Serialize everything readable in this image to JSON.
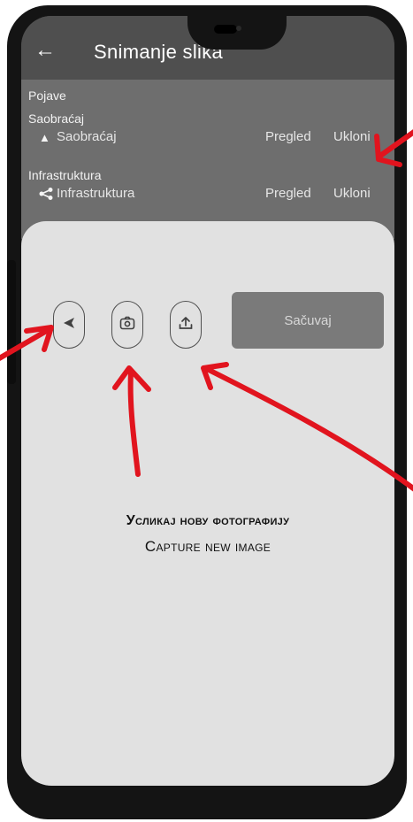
{
  "app": {
    "title": "Snimanje slika"
  },
  "sections": [
    {
      "title": "Pojave"
    },
    {
      "title": "Saobraćaj",
      "item": {
        "label": "Saobraćaj",
        "icon": "warning-icon",
        "pregled": "Pregled",
        "ukloni": "Ukloni"
      }
    },
    {
      "title": "Infrastruktura",
      "item": {
        "label": "Infrastruktura",
        "icon": "share-icon",
        "pregled": "Pregled",
        "ukloni": "Ukloni"
      }
    }
  ],
  "sheet": {
    "save_label": "Sačuvaj",
    "buttons": {
      "back": "back-triangle-icon",
      "camera": "camera-icon",
      "upload": "upload-icon"
    }
  },
  "annotation": {
    "title": "Усликај нову фотографију",
    "subtitle": "Capture new image"
  },
  "colors": {
    "arrow": "#e1141e",
    "save_button": "#7a7a7a",
    "sheet": "#e1e1e1",
    "list": "#6e6e6e"
  }
}
